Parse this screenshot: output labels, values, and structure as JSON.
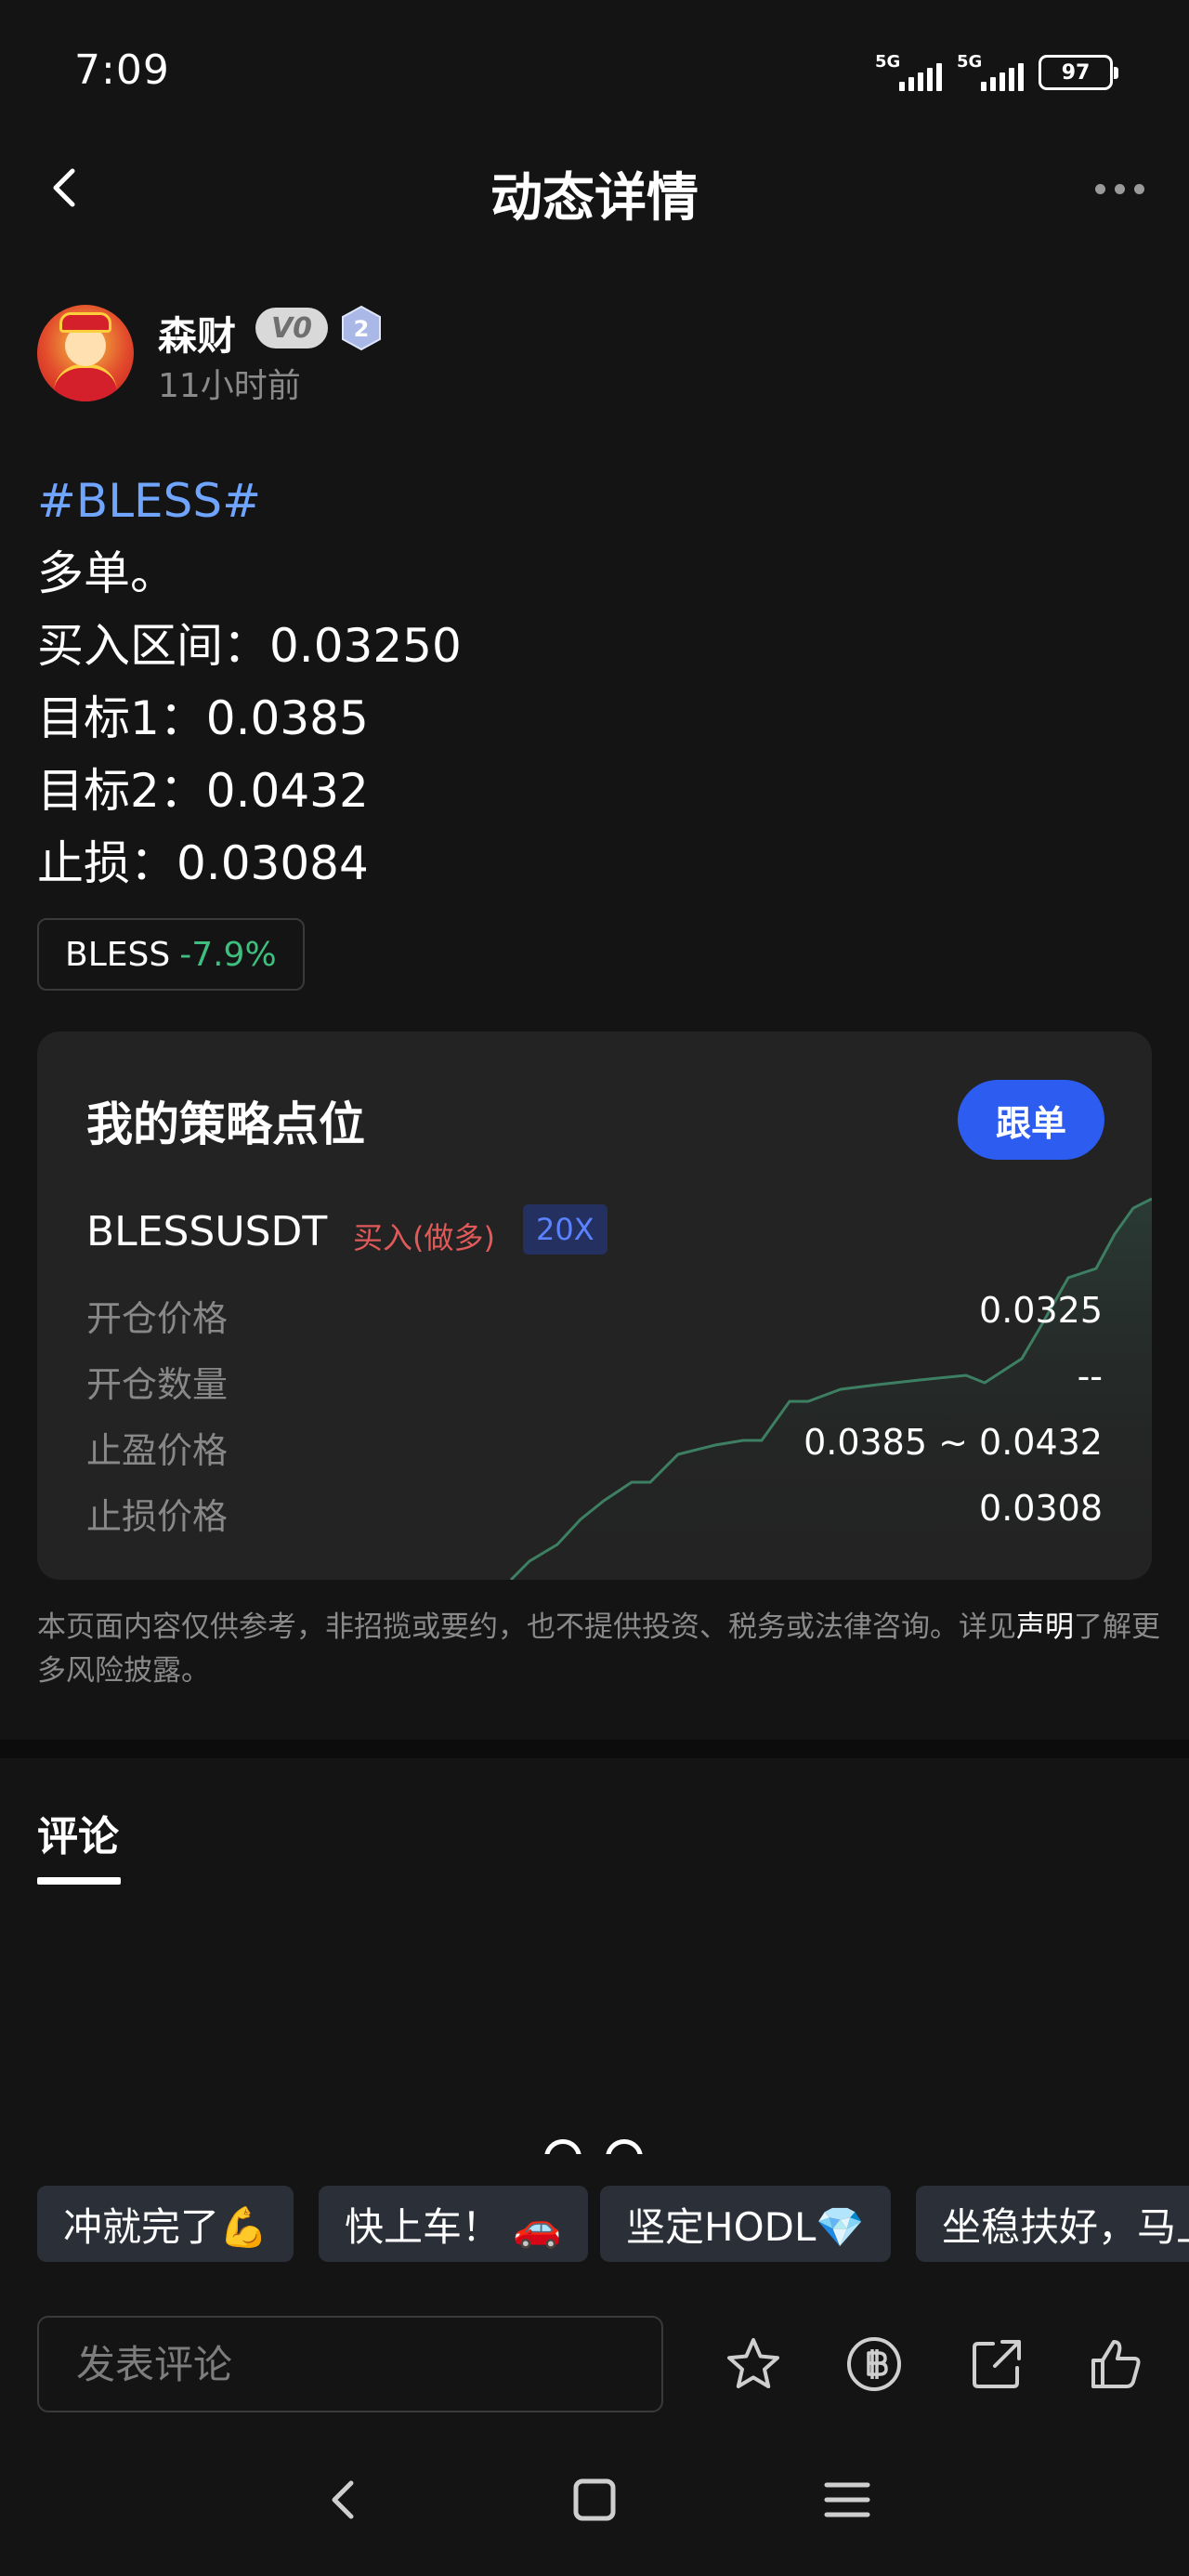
{
  "status_bar": {
    "time": "7:09",
    "signal1": "5G",
    "signal2": "5G",
    "battery": "97"
  },
  "header": {
    "title": "动态详情"
  },
  "author": {
    "name": "森财",
    "vip": "V0",
    "level": "2",
    "time": "11小时前"
  },
  "post": {
    "hashtag": "#BLESS#",
    "lines": [
      "多单。",
      "买入区间：0.03250",
      "目标1：0.0385",
      "目标2：0.0432",
      "止损：0.03084"
    ]
  },
  "coin_tag": {
    "symbol": "BLESS",
    "change": "-7.9%"
  },
  "strategy": {
    "title": "我的策略点位",
    "follow_label": "跟单",
    "pair": "BLESSUSDT",
    "side": "买入(做多)",
    "leverage": "20X",
    "rows": [
      {
        "label": "开仓价格",
        "value": "0.0325"
      },
      {
        "label": "开仓数量",
        "value": "--"
      },
      {
        "label": "止盈价格",
        "value": "0.0385 ~ 0.0432"
      },
      {
        "label": "止损价格",
        "value": "0.0308"
      }
    ]
  },
  "disclaimer": {
    "text": "本页面内容仅供参考，非招揽或要约，也不提供投资、税务或法律咨询。详见",
    "link": "声明",
    "tail": "了解更多风险披露。"
  },
  "comments": {
    "tab_label": "评论"
  },
  "quick_replies": [
    "冲就完了💪",
    "快上车！ 🚗",
    "坚定HODL💎",
    "坐稳扶好，马上"
  ],
  "bottom_bar": {
    "comment_placeholder": "发表评论"
  },
  "icons": {
    "back": "back-icon",
    "more": "more-icon",
    "star": "star-icon",
    "coin": "coin-icon",
    "share": "share-icon",
    "like": "thumbs-up-icon",
    "nav_back": "nav-back-icon",
    "nav_home": "nav-home-icon",
    "nav_menu": "nav-menu-icon"
  },
  "colors": {
    "accent": "#2d5cf0",
    "hashtag": "#6fa4ff",
    "up": "#3fbf7f",
    "buy": "#e05a5a"
  }
}
